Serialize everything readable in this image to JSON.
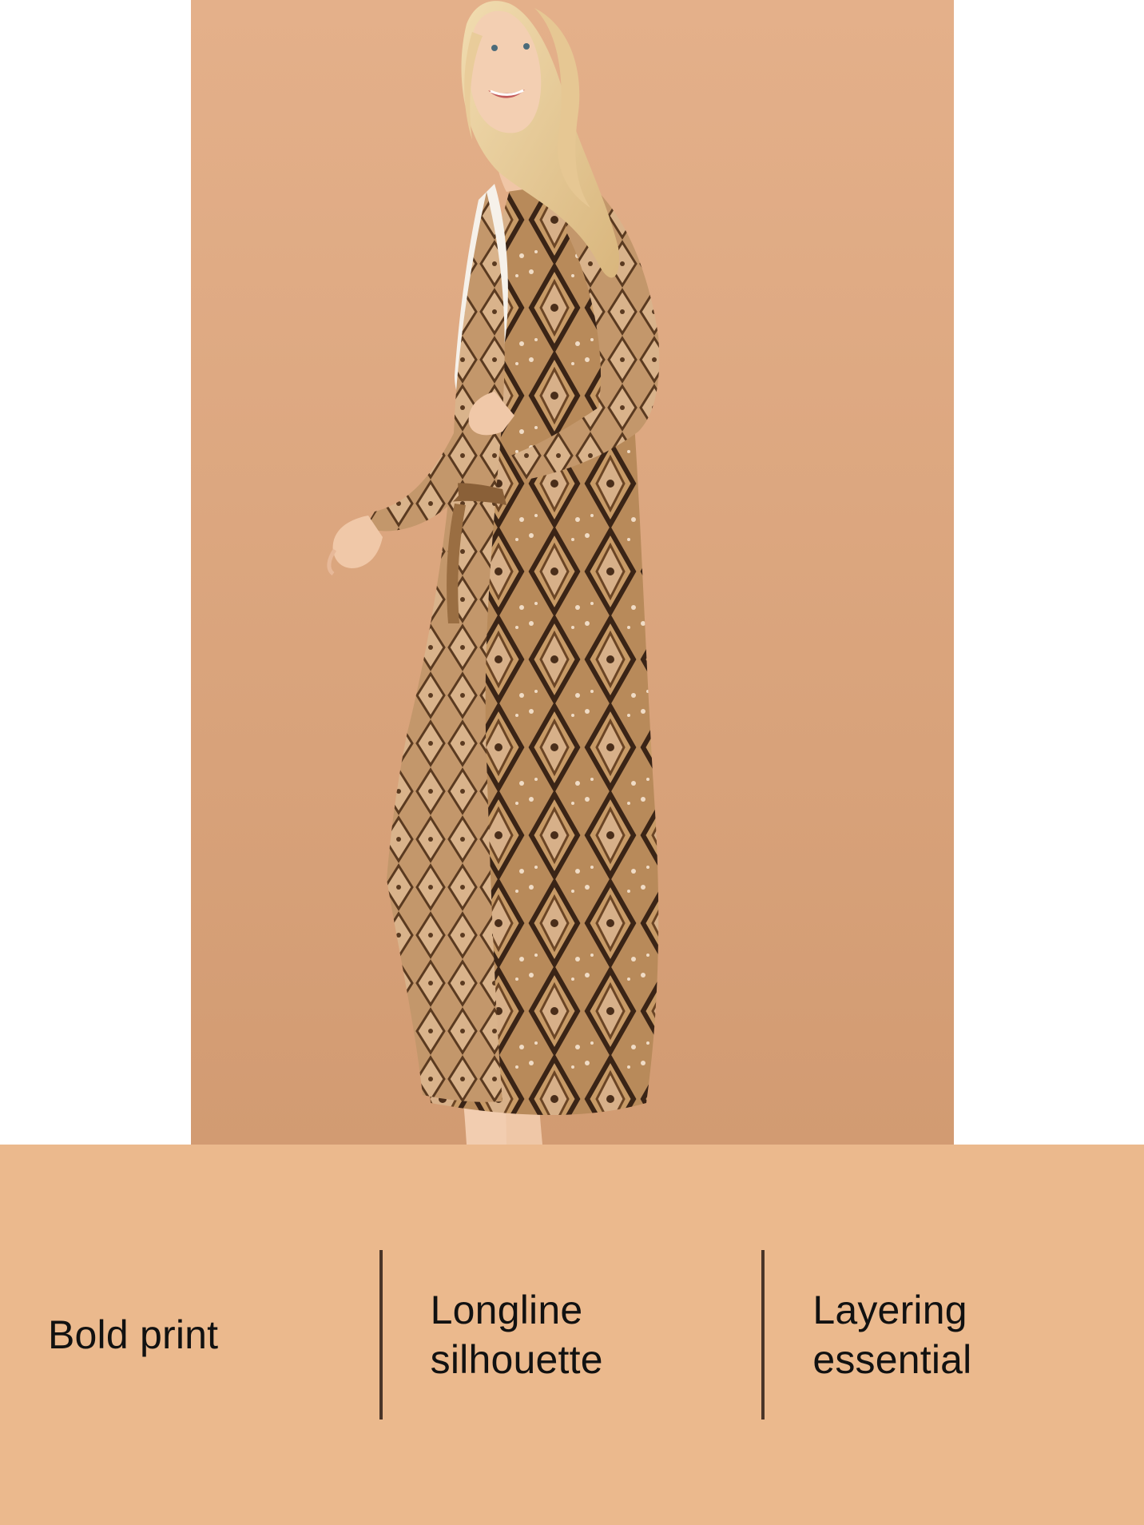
{
  "colors": {
    "photo_background": "#D9A47C",
    "feature_strip": "#EBB98D",
    "divider": "#4A3528",
    "text": "#111111"
  },
  "product_image": {
    "subject": "model-wearing-snakeskin-print-longline-cardigan"
  },
  "features": [
    {
      "label": "Bold print"
    },
    {
      "label": "Longline silhouette"
    },
    {
      "label": "Layering essential"
    }
  ]
}
